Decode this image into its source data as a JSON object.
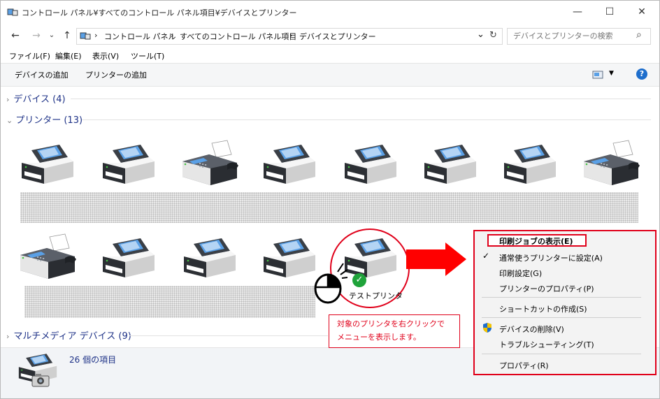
{
  "window": {
    "title": "コントロール パネル¥すべてのコントロール パネル項目¥デバイスとプリンター",
    "minimize": "—",
    "maximize": "☐",
    "close": "✕"
  },
  "address": {
    "crumbs": [
      "コントロール パネル",
      "すべてのコントロール パネル項目",
      "デバイスとプリンター"
    ],
    "separator": "›",
    "dropdown": "⌄",
    "refresh": "↻"
  },
  "search": {
    "placeholder": "デバイスとプリンターの検索",
    "icon": "⌕"
  },
  "menubar": [
    "ファイル(F)",
    "編集(E)",
    "表示(V)",
    "ツール(T)"
  ],
  "commands": {
    "add_device": "デバイスの追加",
    "add_printer": "プリンターの追加",
    "help": "?"
  },
  "groups": {
    "devices": "デバイス (4)",
    "printers": "プリンター (13)",
    "multimedia": "マルチメディア デバイス (9)"
  },
  "printers": {
    "row1": [
      "printer",
      "printer",
      "fax",
      "printer",
      "printer",
      "printer",
      "printer",
      "fax"
    ],
    "row2": [
      "fax",
      "printer",
      "printer",
      "printer",
      "printer"
    ],
    "selected_label": "テストプリンタ",
    "status_ok": "✓"
  },
  "status": {
    "count": "26 個の項目"
  },
  "context_menu": {
    "items": [
      "印刷ジョブの表示(E)",
      "通常使うプリンターに設定(A)",
      "印刷設定(G)",
      "プリンターのプロパティ(P)",
      "ショートカットの作成(S)",
      "デバイスの削除(V)",
      "トラブルシューティング(T)",
      "プロパティ(R)"
    ],
    "check": "✓"
  },
  "callout": {
    "line1": "対象のプリンタを右クリックで",
    "line2": "メニューを表示します。"
  },
  "colors": {
    "accent": "#e0001a",
    "group_header": "#1e3287",
    "help": "#1e6ecc",
    "ok": "#1fa33a"
  }
}
